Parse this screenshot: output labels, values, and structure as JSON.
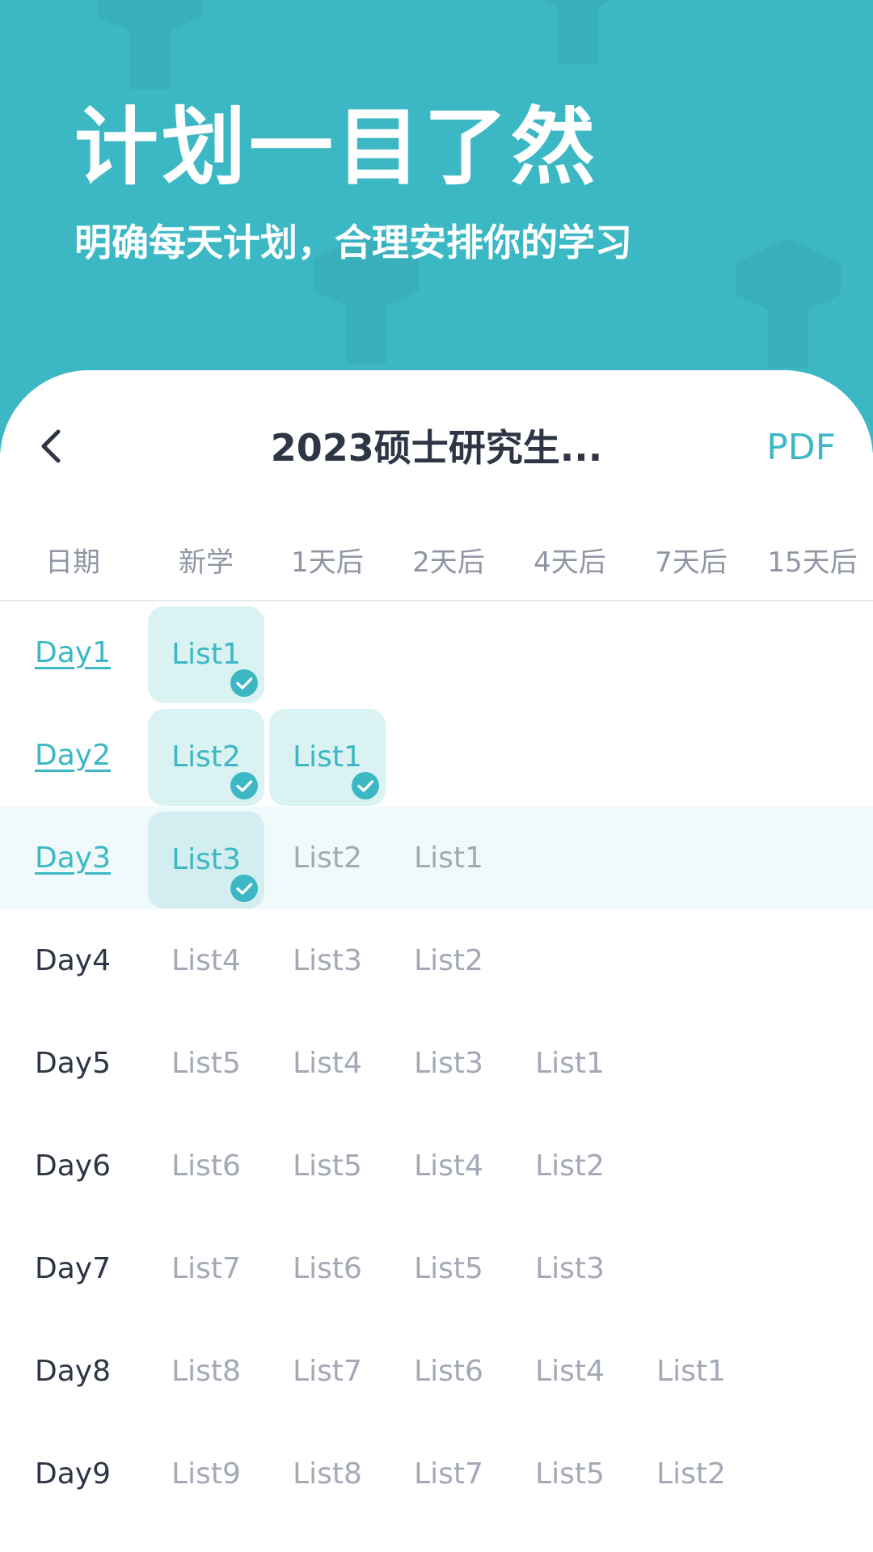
{
  "hero": {
    "title": "计划一目了然",
    "subtitle": "明确每天计划，合理安排你的学习"
  },
  "nav": {
    "back_icon": "chevron-left-icon",
    "title": "2023硕士研究生...",
    "pdf_label": "PDF"
  },
  "table": {
    "headers": [
      "日期",
      "新学",
      "1天后",
      "2天后",
      "4天后",
      "7天后",
      "15天后"
    ],
    "rows": [
      {
        "day": "Day1",
        "status": "done",
        "cells": [
          "List1",
          "",
          "",
          "",
          "",
          ""
        ],
        "checked": [
          true,
          false,
          false,
          false,
          false,
          false
        ]
      },
      {
        "day": "Day2",
        "status": "done",
        "cells": [
          "List2",
          "List1",
          "",
          "",
          "",
          ""
        ],
        "checked": [
          true,
          true,
          false,
          false,
          false,
          false
        ]
      },
      {
        "day": "Day3",
        "status": "current",
        "cells": [
          "List3",
          "List2",
          "List1",
          "",
          "",
          ""
        ],
        "checked": [
          true,
          false,
          false,
          false,
          false,
          false
        ]
      },
      {
        "day": "Day4",
        "status": "upcoming",
        "cells": [
          "List4",
          "List3",
          "List2",
          "",
          "",
          ""
        ],
        "checked": [
          false,
          false,
          false,
          false,
          false,
          false
        ]
      },
      {
        "day": "Day5",
        "status": "upcoming",
        "cells": [
          "List5",
          "List4",
          "List3",
          "List1",
          "",
          ""
        ],
        "checked": [
          false,
          false,
          false,
          false,
          false,
          false
        ]
      },
      {
        "day": "Day6",
        "status": "upcoming",
        "cells": [
          "List6",
          "List5",
          "List4",
          "List2",
          "",
          ""
        ],
        "checked": [
          false,
          false,
          false,
          false,
          false,
          false
        ]
      },
      {
        "day": "Day7",
        "status": "upcoming",
        "cells": [
          "List7",
          "List6",
          "List5",
          "List3",
          "",
          ""
        ],
        "checked": [
          false,
          false,
          false,
          false,
          false,
          false
        ]
      },
      {
        "day": "Day8",
        "status": "upcoming",
        "cells": [
          "List8",
          "List7",
          "List6",
          "List4",
          "List1",
          ""
        ],
        "checked": [
          false,
          false,
          false,
          false,
          false,
          false
        ]
      },
      {
        "day": "Day9",
        "status": "upcoming",
        "cells": [
          "List9",
          "List8",
          "List7",
          "List5",
          "List2",
          ""
        ],
        "checked": [
          false,
          false,
          false,
          false,
          false,
          false
        ]
      }
    ]
  },
  "colors": {
    "accent": "#3cb8c4",
    "chip_bg": "#dbf2f2",
    "current_row_bg": "#f0fafa",
    "text_dark": "#2e3545",
    "text_muted": "#a3a9b5"
  }
}
